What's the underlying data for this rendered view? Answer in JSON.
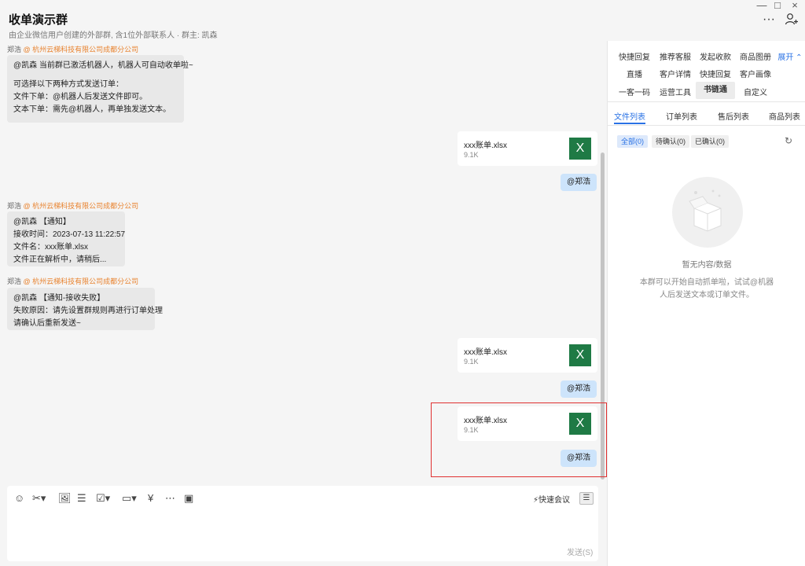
{
  "header": {
    "title": "收单演示群",
    "subtitle": "由企业微信用户创建的外部群, 含1位外部联系人 · 群主: 凯森",
    "window_controls": [
      "—",
      "□",
      "×"
    ],
    "more_icon": "···",
    "add_member_icon": "person-plus-icon"
  },
  "messages": [
    {
      "sender": "郑浩",
      "company": "@ 杭州云梯科技有限公司成都分公司",
      "lines": [
        "@凯森 当前群已激活机器人，机器人可自动收单啦~",
        "",
        "可选择以下两种方式发送订单：",
        "文件下单：@机器人后发送文件即可。",
        "文本下单：需先@机器人，再单独发送文本。"
      ]
    },
    {
      "sender": "郑浩",
      "company": "@ 杭州云梯科技有限公司成都分公司",
      "lines": [
        "@凯森 【通知】",
        "接收时间：2023-07-13 11:22:57",
        "文件名：xxx账单.xlsx",
        "文件正在解析中，请稍后..."
      ]
    },
    {
      "sender": "郑浩",
      "company": "@ 杭州云梯科技有限公司成都分公司",
      "lines": [
        "@凯森 【通知-接收失败】",
        "失败原因：请先设置群规则再进行订单处理",
        "请确认后重新发送~"
      ]
    }
  ],
  "files": [
    {
      "name": "xxx账单.xlsx",
      "size": "9.1K",
      "icon": "X",
      "mention": "@郑浩"
    },
    {
      "name": "xxx账单.xlsx",
      "size": "9.1K",
      "icon": "X",
      "mention": "@郑浩"
    },
    {
      "name": "xxx账单.xlsx",
      "size": "9.1K",
      "icon": "X",
      "mention": "@郑浩"
    }
  ],
  "composer": {
    "tools": [
      "☺",
      "✂▾",
      "🖼",
      "☰",
      "☑▾",
      "▭▾",
      "¥",
      "⋯",
      "▣"
    ],
    "tool_names": [
      "emoji-icon",
      "scissors-icon",
      "image-icon",
      "document-icon",
      "checkbox-icon",
      "folder-icon",
      "red-packet-icon",
      "more-circle-icon",
      "screen-icon"
    ],
    "quick_meeting": "⚡快速会议",
    "panel_toggle": "☰",
    "send": "发送(S)"
  },
  "panel": {
    "tool_rows": [
      [
        "快捷回复",
        "推荐客服",
        "发起收款",
        "商品图册"
      ],
      [
        "直播",
        "客户详情",
        "快捷回复",
        "客户画像"
      ],
      [
        "一客一码",
        "运营工具",
        "书链通",
        "自定义"
      ]
    ],
    "expand": "展开 ⌃",
    "active_tool": "书链通",
    "tabs": [
      "文件列表",
      "订单列表",
      "售后列表",
      "商品列表"
    ],
    "filters": [
      "全部(0)",
      "待确认(0)",
      "已确认(0)"
    ],
    "refresh_icon": "↻",
    "empty_title": "暂无内容/数据",
    "empty_desc": "本群可以开始自动抓单啦，试试@机器人后发送文本或订单文件。"
  },
  "colors": {
    "accent": "#2a72e5",
    "company": "#e8822e",
    "excel": "#1f7a45",
    "mention_bubble": "#cde4fb",
    "highlight": "#e03030"
  }
}
